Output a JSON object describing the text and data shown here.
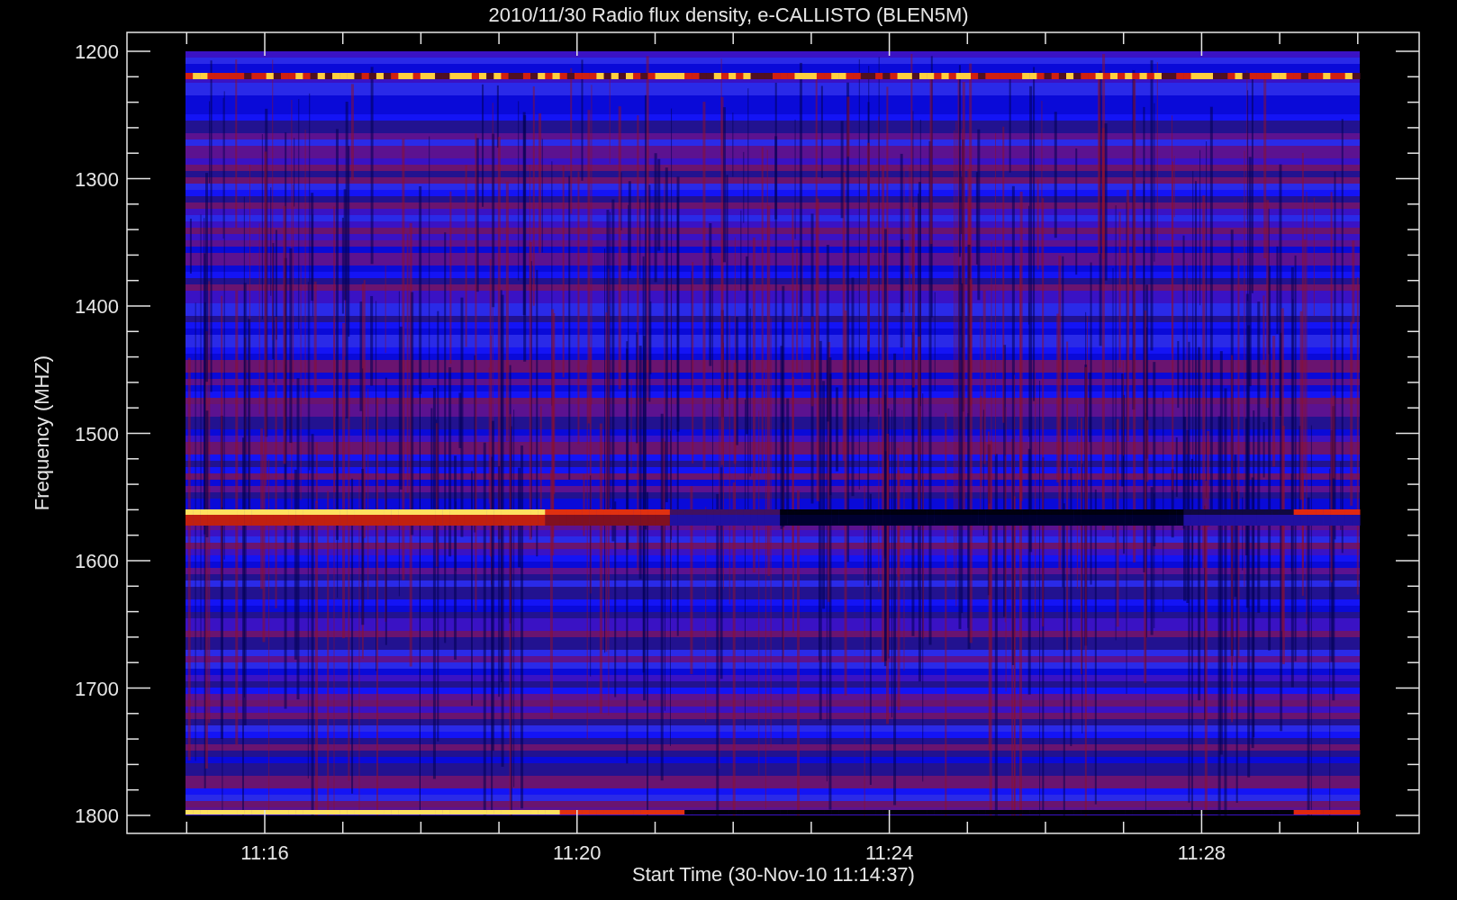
{
  "title": "2010/11/30  Radio flux density, e-CALLISTO (BLEN5M)",
  "ylabel": "Frequency (MHZ)",
  "xlabel": "Start Time (30-Nov-10 11:14:37)",
  "yticks": [
    "1200",
    "1300",
    "1400",
    "1500",
    "1600",
    "1700",
    "1800"
  ],
  "xticks": [
    "11:16",
    "11:20",
    "11:24",
    "11:28"
  ]
}
